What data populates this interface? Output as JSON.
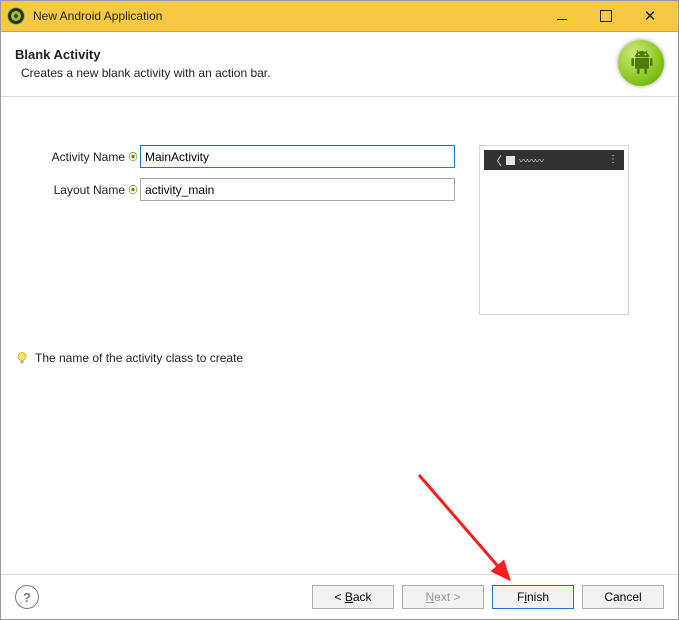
{
  "window": {
    "title": "New Android Application"
  },
  "header": {
    "title": "Blank Activity",
    "subtitle": "Creates a new blank activity with an action bar."
  },
  "fields": {
    "activity_name": {
      "label": "Activity Name",
      "value": "MainActivity"
    },
    "layout_name": {
      "label": "Layout Name",
      "value": "activity_main"
    }
  },
  "hint": {
    "text": "The name of the activity class to create"
  },
  "buttons": {
    "back": "< Back",
    "next": "Next >",
    "finish_pre": "F",
    "finish_mn": "i",
    "finish_post": "nish",
    "cancel": "Cancel"
  }
}
